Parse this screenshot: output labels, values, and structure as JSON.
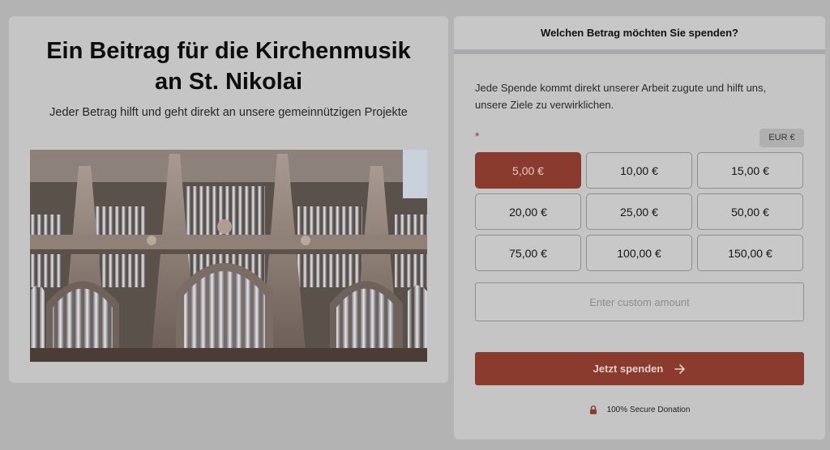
{
  "campaign": {
    "title_line1": "Ein Beitrag für die Kirchenmusik",
    "title_line2": "an St. Nikolai",
    "subtitle": "Jeder Betrag hilft und geht direkt an unsere gemeinnützigen Projekte",
    "image_icon": "church-organ-photo"
  },
  "donation_form": {
    "header": "Welchen Betrag möchten Sie spenden?",
    "intro": "Jede Spende kommt direkt unserer Arbeit zugute und hilft uns, unsere Ziele zu verwirklichen.",
    "required_marker": "*",
    "currency": "EUR  €",
    "amounts": [
      {
        "label": "5,00 €",
        "selected": true
      },
      {
        "label": "10,00 €",
        "selected": false
      },
      {
        "label": "15,00 €",
        "selected": false
      },
      {
        "label": "20,00 €",
        "selected": false
      },
      {
        "label": "25,00 €",
        "selected": false
      },
      {
        "label": "50,00 €",
        "selected": false
      },
      {
        "label": "75,00 €",
        "selected": false
      },
      {
        "label": "100,00 €",
        "selected": false
      },
      {
        "label": "150,00 €",
        "selected": false
      }
    ],
    "custom_amount_placeholder": "Enter custom amount",
    "custom_amount_value": "",
    "submit_label": "Jetzt spenden",
    "submit_icon": "arrow-right-icon",
    "secure_label": "100% Secure Donation",
    "secure_icon": "lock-icon"
  },
  "colors": {
    "accent": "#8a3b2d",
    "backdrop": "#b3b3b3",
    "card": "#c5c5c5"
  }
}
